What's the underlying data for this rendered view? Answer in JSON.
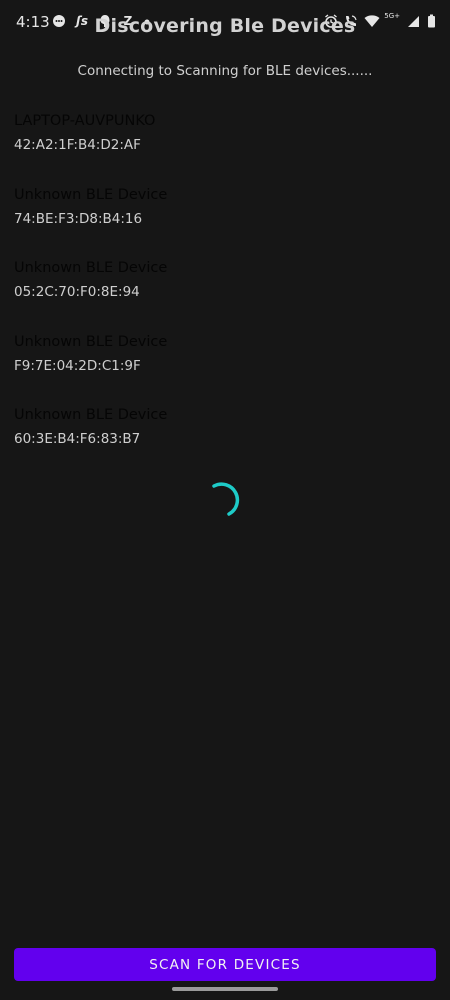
{
  "status_bar": {
    "time": "4:13",
    "left_icons": [
      "message-icon",
      "js-icon",
      "ghost-icon",
      "z-icon",
      "dot-icon"
    ],
    "right_icons": [
      "alarm-icon",
      "wifi-call-icon",
      "wifi-icon",
      "signal-icon",
      "battery-icon"
    ],
    "network_label": "5G+"
  },
  "header": {
    "title": "Discovering Ble Devices",
    "status_text": "Connecting to Scanning for BLE devices......"
  },
  "devices": [
    {
      "name": "LAPTOP-AUVPUNKO",
      "address": "42:A2:1F:B4:D2:AF"
    },
    {
      "name": "Unknown BLE Device",
      "address": "74:BE:F3:D8:B4:16"
    },
    {
      "name": "Unknown BLE Device",
      "address": "05:2C:70:F0:8E:94"
    },
    {
      "name": "Unknown BLE Device",
      "address": "F9:7E:04:2D:C1:9F"
    },
    {
      "name": "Unknown BLE Device",
      "address": "60:3E:B4:F6:83:B7"
    }
  ],
  "loading": {
    "icon": "loading-spinner-icon",
    "color": "#1ecbc8"
  },
  "actions": {
    "scan_label": "SCAN FOR DEVICES",
    "scan_color": "#6200ee"
  }
}
